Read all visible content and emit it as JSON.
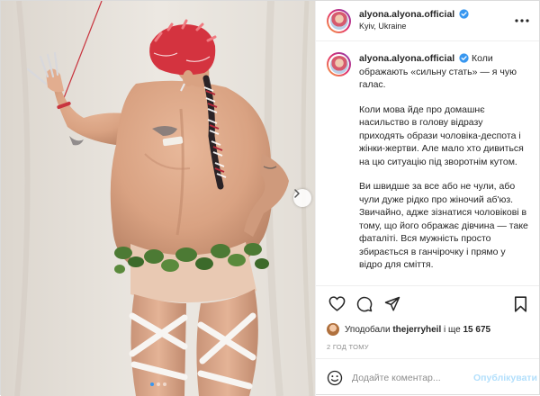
{
  "post": {
    "username": "alyona.alyona.official",
    "location": "Kyiv, Ukraine",
    "caption": {
      "intro": "Коли ображають «сильну стать» — я чую галас.",
      "paragraphs": [
        "Коли мова йде про домашнє насильство в голову відразу приходять образи чоловіка-деспота і жінки-жертви. Але мало хто дивиться на цю ситуацію під зворотнім кутом.",
        "Ви швидше за все або не чули, або чули дуже рідко про жіночий аб'юз. Звичайно, адже зізнатися чоловікові в тому, що його ображає дівчина — таке фаталіті. Вся мужність просто збирається в ганчірочку і прямо у відро для сміття."
      ]
    },
    "likes": {
      "prefix": "Уподобали",
      "user": "thejerryheil",
      "connector": "і ще",
      "count": "15 675"
    },
    "time": "2 год тому",
    "comment": {
      "placeholder": "Додайте коментар...",
      "publish_label": "Опублікувати"
    }
  },
  "icons": {
    "verified": "verified-badge-icon",
    "more": "more-options-icon",
    "like": "heart-icon",
    "comment": "comment-bubble-icon",
    "share": "paper-plane-icon",
    "save": "bookmark-icon",
    "emoji": "emoji-smile-icon",
    "next": "chevron-right-icon"
  },
  "colors": {
    "verified": "#3897f0",
    "publish_disabled": "#b2dffc",
    "active_dot": "#3897f0"
  }
}
